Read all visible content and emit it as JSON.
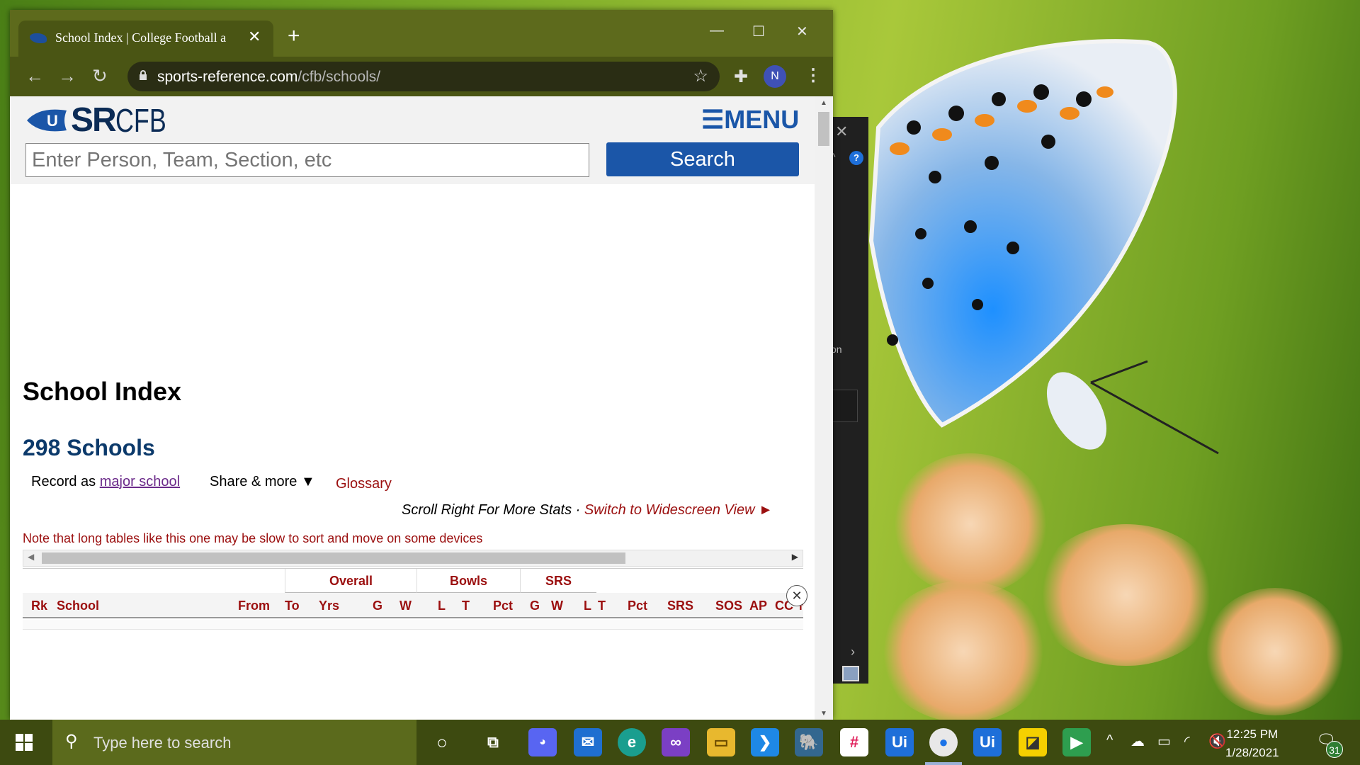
{
  "browser": {
    "tab_title": "School Index | College Football a",
    "url_domain": "sports-reference.com",
    "url_path": "/cfb/schools/",
    "profile_initial": "N"
  },
  "site": {
    "logo_sr": "SR",
    "logo_cfb": "CFB",
    "menu_label": "☰MENU",
    "search_placeholder": "Enter Person, Team, Section, etc",
    "search_button": "Search"
  },
  "content": {
    "page_title": "School Index",
    "count_heading": "298 Schools",
    "record_as_prefix": "Record as ",
    "record_as_link": "major school",
    "share_more": "Share & more ▼",
    "glossary": "Glossary",
    "scroll_right": "Scroll Right For More Stats · ",
    "widescreen": "Switch to Widescreen View ►",
    "note": "Note that long tables like this one may be slow to sort and move on some devices"
  },
  "table": {
    "over_headers": [
      "Overall",
      "Bowls",
      "SRS"
    ],
    "columns": [
      "Rk",
      "School",
      "From",
      "To",
      "Yrs",
      "G",
      "W",
      "L",
      "T",
      "Pct",
      "G",
      "W",
      "L",
      "T",
      "Pct",
      "SRS",
      "SOS",
      "AP",
      "CC",
      "N"
    ]
  },
  "side_panel": {
    "partial_text": "on"
  },
  "taskbar": {
    "search_placeholder": "Type here to search",
    "time": "12:25 PM",
    "date": "1/28/2021",
    "notification_count": "31",
    "uipath_label": "Ui"
  },
  "colors": {
    "accent_red": "#9b0f0f",
    "brand_blue": "#1b56a8",
    "logo_navy": "#0c2c56",
    "titlebar": "#5d6a1c",
    "taskbar": "#3d4a10"
  }
}
